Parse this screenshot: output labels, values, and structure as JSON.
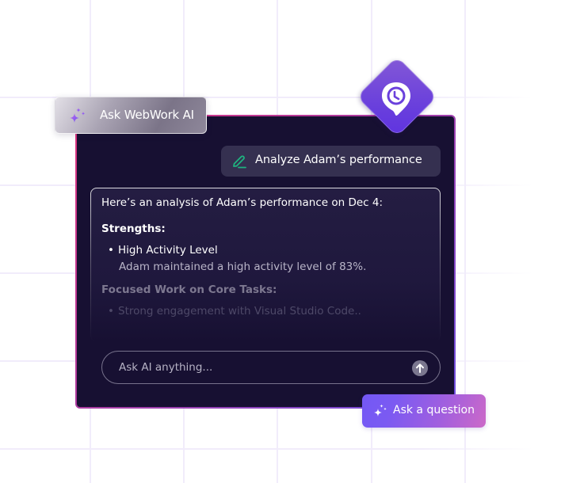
{
  "colors": {
    "panel_bg": "#171032",
    "panel_border_accent": "#e0357f",
    "brand_purple": "#6a40dc",
    "pen_icon_green": "#1fb27f",
    "cta_gradient_start": "#7358f5",
    "cta_gradient_end": "#cc69c8"
  },
  "chip": {
    "icon": "sparkles-icon",
    "label": "Ask WebWork AI"
  },
  "badge": {
    "icon": "location-clock-icon"
  },
  "prompt": {
    "icon": "pen-icon",
    "text": "Analyze Adam’s performance"
  },
  "response": {
    "intro": "Here’s an analysis of Adam’s performance on Dec 4:",
    "sections": [
      {
        "heading": "Strengths:",
        "items": [
          {
            "bullet": "•",
            "title": "High Activity Level",
            "detail": "Adam maintained a high activity level of 83%."
          }
        ]
      },
      {
        "heading": "Focused Work on Core Tasks:",
        "items": [
          {
            "bullet": "•",
            "title": "Strong engagement with Visual Studio Code.."
          }
        ]
      }
    ]
  },
  "input": {
    "placeholder": "Ask AI anything...",
    "send_icon": "arrow-up-icon"
  },
  "cta": {
    "icon": "sparkles-icon",
    "label": "Ask a question"
  }
}
